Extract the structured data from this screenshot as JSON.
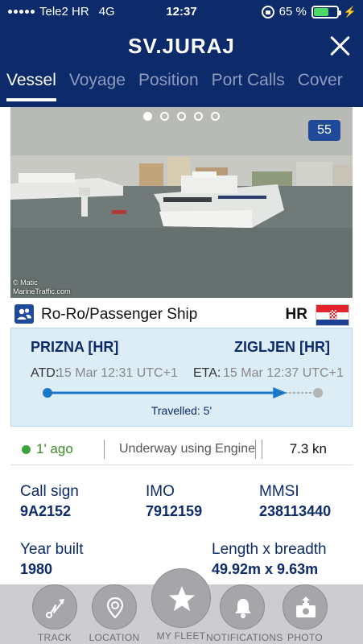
{
  "status_bar": {
    "carrier": "Tele2 HR",
    "network": "4G",
    "time": "12:37",
    "battery": "65 %",
    "battery_level": 0.65
  },
  "header": {
    "title": "SV.JURAJ",
    "tabs": [
      {
        "label": "Vessel",
        "active": true
      },
      {
        "label": "Voyage",
        "active": false
      },
      {
        "label": "Position",
        "active": false
      },
      {
        "label": "Port Calls",
        "active": false
      },
      {
        "label": "Cover",
        "active": false
      }
    ]
  },
  "photo": {
    "count": "55",
    "credit_line1": "© Matic",
    "credit_line2": "MarineTraffic.com",
    "dot_count": 5,
    "active_dot": 1
  },
  "vessel": {
    "type": "Ro-Ro/Passenger Ship",
    "flag_code": "HR"
  },
  "route": {
    "from": "PRIZNA [HR]",
    "to": "ZIGLJEN [HR]",
    "atd_label": "ATD:",
    "atd_value": "15 Mar 12:31 UTC+1",
    "eta_label": "ETA:",
    "eta_value": "15 Mar 12:37 UTC+1",
    "travelled": "Travelled: 5'",
    "progress": 0.87
  },
  "status": {
    "last_seen": "1' ago",
    "nav_status": "Underway using Engine",
    "speed": "7.3 kn"
  },
  "details": {
    "call_sign_label": "Call sign",
    "call_sign": "9A2152",
    "imo_label": "IMO",
    "imo": "7912159",
    "mmsi_label": "MMSI",
    "mmsi": "238113440",
    "year_built_label": "Year built",
    "year_built": "1980",
    "dimensions_label": "Length x breadth",
    "dimensions": "49.92m x 9.63m"
  },
  "toolbar": {
    "items": [
      {
        "label": "TRACK",
        "icon": "track-icon"
      },
      {
        "label": "LOCATION",
        "icon": "location-pin-icon"
      },
      {
        "label": "MY FLEET",
        "icon": "star-icon"
      },
      {
        "label": "NOTIFICATIONS",
        "icon": "bell-icon"
      },
      {
        "label": "PHOTO",
        "icon": "camera-upload-icon"
      }
    ]
  },
  "colors": {
    "header_bg": "#0d2a6b",
    "accent": "#1f4a9a",
    "route_bg": "#dcedf6",
    "progress": "#1a78c8",
    "status_green": "#3aa33a"
  }
}
